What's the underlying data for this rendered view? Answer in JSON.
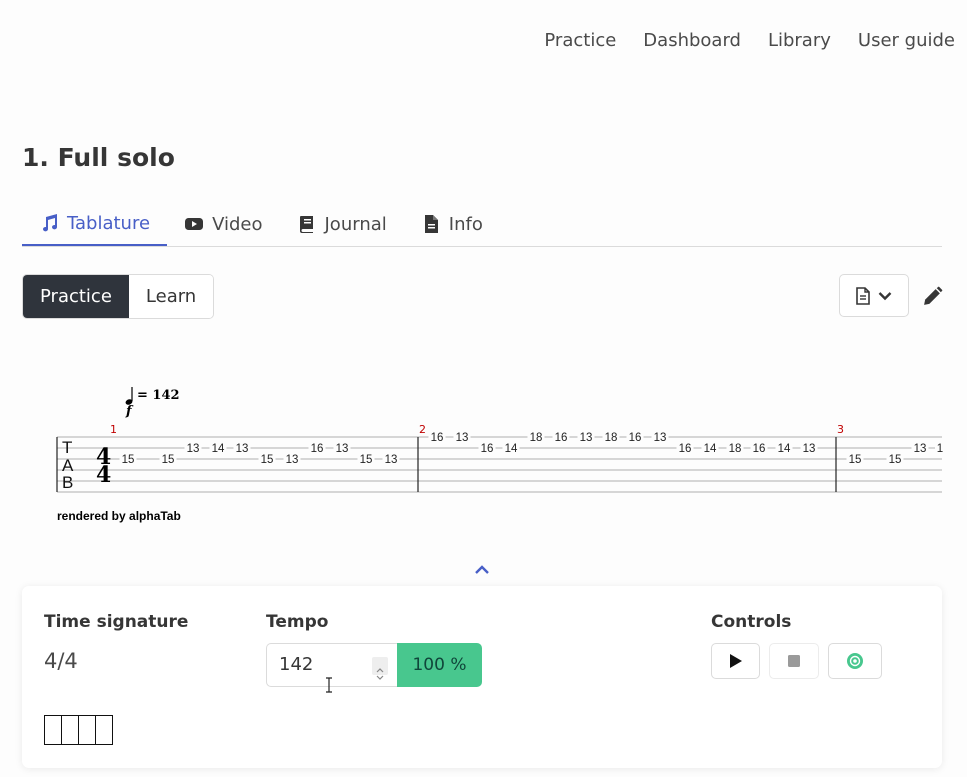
{
  "nav": {
    "items": [
      "Practice",
      "Dashboard",
      "Library",
      "User guide"
    ]
  },
  "page": {
    "title": "1. Full solo"
  },
  "tabs": [
    {
      "label": "Tablature",
      "icon": "music-note-icon",
      "active": true
    },
    {
      "label": "Video",
      "icon": "youtube-icon",
      "active": false
    },
    {
      "label": "Journal",
      "icon": "book-icon",
      "active": false
    },
    {
      "label": "Info",
      "icon": "file-icon",
      "active": false
    }
  ],
  "mode": {
    "practice": "Practice",
    "learn": "Learn",
    "selected": "Practice"
  },
  "score": {
    "tempo_mark": "= 142",
    "dynamic": "f",
    "tab_clef": [
      "T",
      "A",
      "B"
    ],
    "time_signature": [
      "4",
      "4"
    ],
    "bar_numbers": [
      "1",
      "2",
      "3"
    ],
    "frets": [
      "15",
      "15",
      "13",
      "14",
      "13",
      "15",
      "13",
      "16",
      "13",
      "15",
      "13",
      "16",
      "13",
      "16",
      "14",
      "18",
      "16",
      "13",
      "18",
      "16",
      "13",
      "16",
      "14",
      "18",
      "16",
      "14",
      "13",
      "15",
      "15",
      "13",
      "1"
    ],
    "credit": "rendered by alphaTab"
  },
  "panel": {
    "time_signature_label": "Time signature",
    "time_signature_value": "4/4",
    "beat_count": 4,
    "tempo_label": "Tempo",
    "tempo_value": "142",
    "tempo_percent": "100 %",
    "controls_label": "Controls"
  },
  "colors": {
    "accent": "#485fc7",
    "dark_button": "#2f343c",
    "success": "#48c78e",
    "bar_number": "#c00000"
  }
}
